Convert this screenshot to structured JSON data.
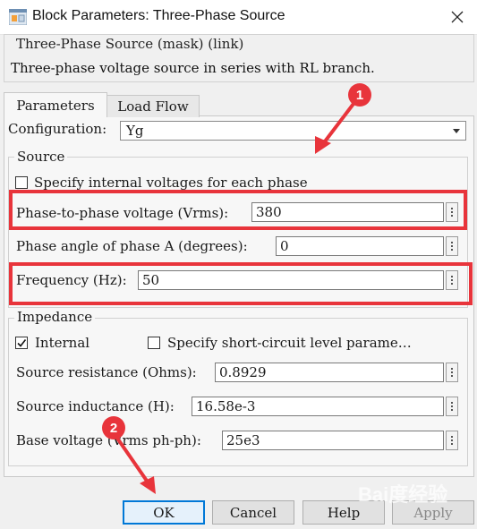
{
  "window": {
    "title": "Block Parameters: Three-Phase Source"
  },
  "description": {
    "title": "Three-Phase Source (mask) (link)",
    "text": "Three-phase voltage source in series with RL branch."
  },
  "tabs": [
    {
      "label": "Parameters"
    },
    {
      "label": "Load Flow"
    }
  ],
  "configuration": {
    "label": "Configuration:",
    "value": "Yg"
  },
  "source": {
    "title": "Source",
    "specify_internal": {
      "label": "Specify internal voltages for each phase",
      "checked": false
    },
    "voltage": {
      "label": "Phase-to-phase voltage (Vrms):",
      "value": "380"
    },
    "phase_angle": {
      "label": "Phase angle of phase A (degrees):",
      "value": "0"
    },
    "frequency": {
      "label": "Frequency (Hz):",
      "value": "50"
    }
  },
  "impedance": {
    "title": "Impedance",
    "internal": {
      "label": "Internal",
      "checked": true
    },
    "short_circuit": {
      "label": "Specify short-circuit level parame…",
      "checked": false
    },
    "resistance": {
      "label": "Source resistance (Ohms):",
      "value": "0.8929"
    },
    "inductance": {
      "label": "Source inductance (H):",
      "value": "16.58e-3"
    },
    "base_voltage": {
      "label": "Base voltage (Vrms ph-ph):",
      "value": "25e3"
    }
  },
  "buttons": {
    "ok": "OK",
    "cancel": "Cancel",
    "help": "Help",
    "apply": "Apply"
  },
  "annotations": {
    "badge1": "1",
    "badge2": "2"
  },
  "watermark": "Bai度经验",
  "colors": {
    "highlight": "#e8343b",
    "ok_border": "#0078d7"
  }
}
